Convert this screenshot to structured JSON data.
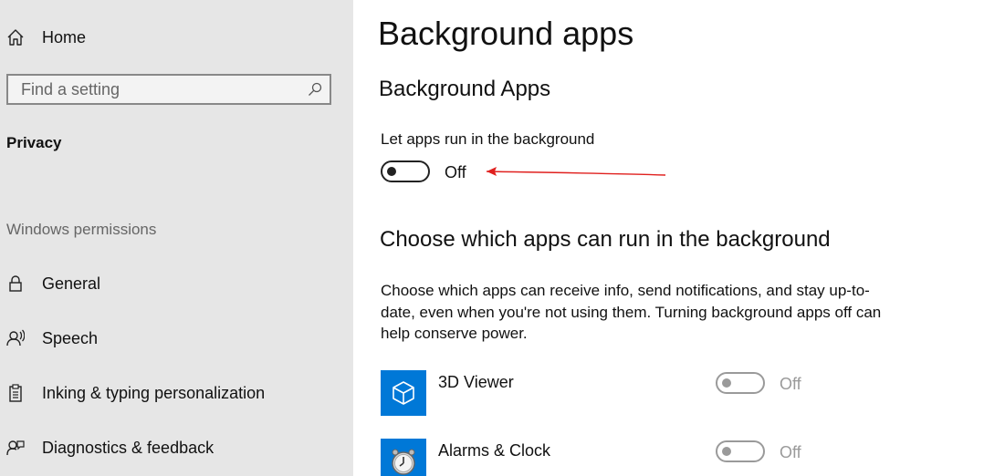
{
  "sidebar": {
    "home_label": "Home",
    "search_placeholder": "Find a setting",
    "section": "Privacy",
    "group": "Windows permissions",
    "items": [
      {
        "label": "General",
        "icon": "lock-icon"
      },
      {
        "label": "Speech",
        "icon": "speech-icon"
      },
      {
        "label": "Inking & typing personalization",
        "icon": "clipboard-icon"
      },
      {
        "label": "Diagnostics & feedback",
        "icon": "feedback-icon"
      }
    ]
  },
  "main": {
    "title": "Background apps",
    "subheading": "Background Apps",
    "toggle_label": "Let apps run in the background",
    "toggle_state": "Off",
    "section2": "Choose which apps can run in the background",
    "description": "Choose which apps can receive info, send notifications, and stay up-to-date, even when you're not using them. Turning background apps off can help conserve power.",
    "apps": [
      {
        "name": "3D Viewer",
        "state": "Off",
        "icon": "cube-icon"
      },
      {
        "name": "Alarms & Clock",
        "state": "Off",
        "icon": "clock-icon"
      }
    ]
  },
  "colors": {
    "sidebar_bg": "#e6e6e6",
    "accent": "#0078d7",
    "annotation_arrow": "#e0201e",
    "disabled": "#9a9a9a"
  }
}
